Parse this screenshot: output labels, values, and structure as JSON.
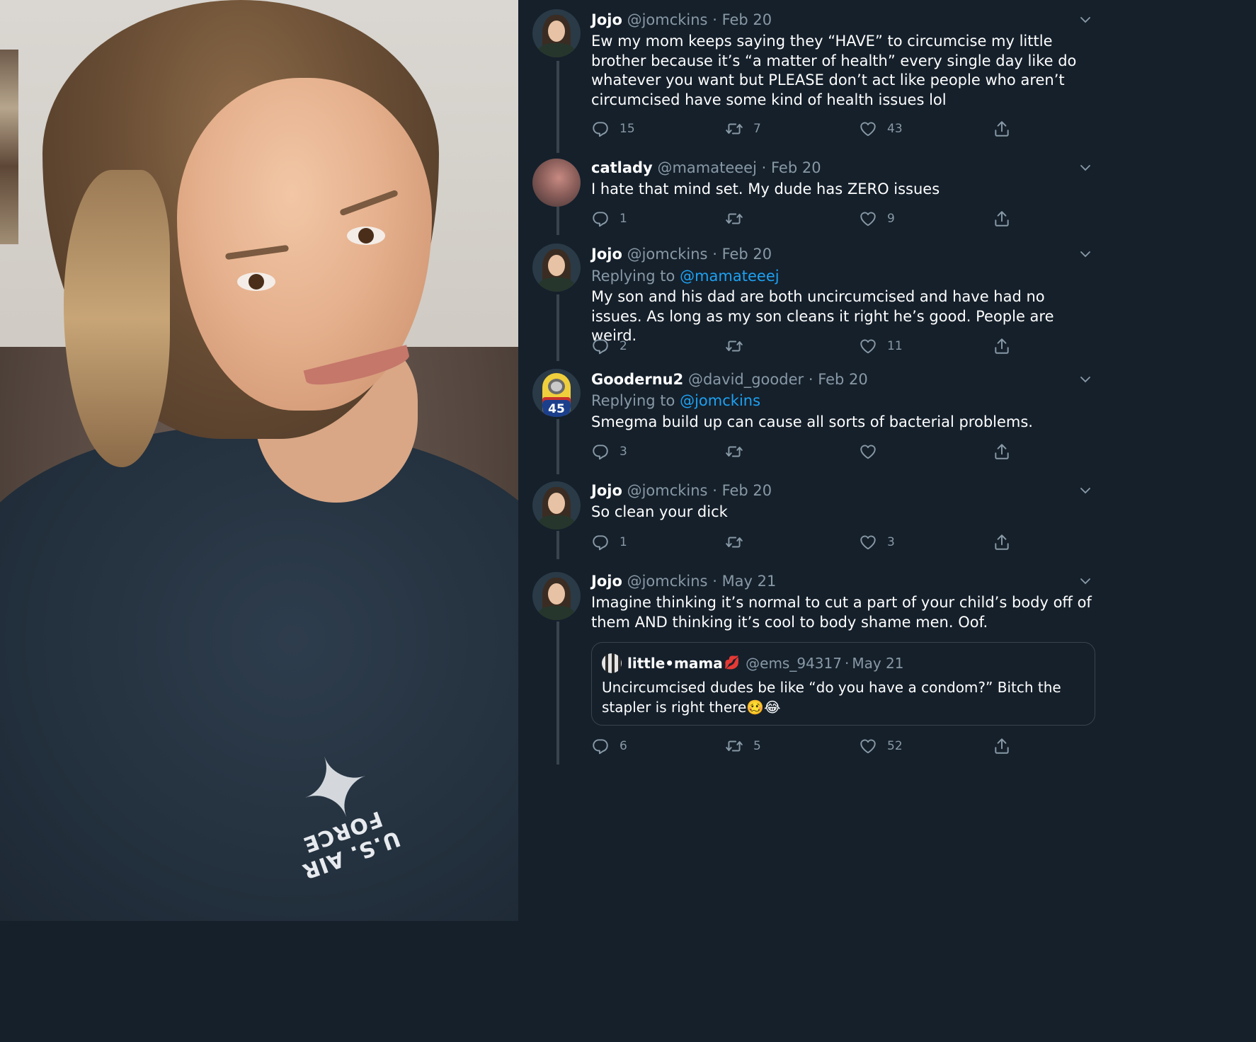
{
  "photo": {
    "shirt_text": "U.S. AIR FORCE",
    "logo_icon": "air-force-wings-icon"
  },
  "colors": {
    "background": "#15202b",
    "text": "#ffffff",
    "muted": "#8899a6",
    "link": "#1da1f2",
    "thread_line": "#38444d"
  },
  "tweets": [
    {
      "name": "Jojo",
      "handle": "@jomckins",
      "sep": "·",
      "date": "Feb 20",
      "replying_prefix": "",
      "replying_to": "",
      "text": "Ew my mom keeps saying they “HAVE” to circumcise my little brother because it’s “a matter of health” every single day like do whatever you want but PLEASE don’t act like people who aren’t circumcised have some kind of health issues lol",
      "replies": "15",
      "retweets": "7",
      "likes": "43"
    },
    {
      "name": "catlady",
      "handle": "@mamateeej",
      "sep": "·",
      "date": "Feb 20",
      "replying_prefix": "",
      "replying_to": "",
      "text": "I hate that mind set. My dude has ZERO issues",
      "replies": "1",
      "retweets": "",
      "likes": "9"
    },
    {
      "name": "Jojo",
      "handle": "@jomckins",
      "sep": "·",
      "date": "Feb 20",
      "replying_prefix": "Replying to",
      "replying_to": "@mamateeej",
      "text": "My son and his dad are both uncircumcised and have had no issues. As long as my son cleans it right he’s good. People are weird.",
      "replies": "2",
      "retweets": "",
      "likes": "11"
    },
    {
      "name": "Goodernu2",
      "handle": "@david_gooder",
      "sep": "·",
      "date": "Feb 20",
      "replying_prefix": "Replying to",
      "replying_to": "@jomckins",
      "text": "Smegma build up can cause all sorts of bacterial problems.",
      "replies": "3",
      "retweets": "",
      "likes": "",
      "avatar_badge": "45"
    },
    {
      "name": "Jojo",
      "handle": "@jomckins",
      "sep": "·",
      "date": "Feb 20",
      "replying_prefix": "",
      "replying_to": "",
      "text": "So clean your dick",
      "replies": "1",
      "retweets": "",
      "likes": "3"
    },
    {
      "name": "Jojo",
      "handle": "@jomckins",
      "sep": "·",
      "date": "May 21",
      "replying_prefix": "",
      "replying_to": "",
      "text": "Imagine thinking it’s normal to cut a part of your child’s body off of them AND thinking it’s cool to body shame men. Oof.",
      "replies": "6",
      "retweets": "5",
      "likes": "52",
      "quote": {
        "name": "little•mama",
        "name_emoji": "💋",
        "handle": "@ems_94317",
        "sep": "·",
        "date": "May 21",
        "text": "Uncircumcised dudes be like “do you have a condom?” Bitch the stapler is right there🥴😂"
      }
    }
  ]
}
